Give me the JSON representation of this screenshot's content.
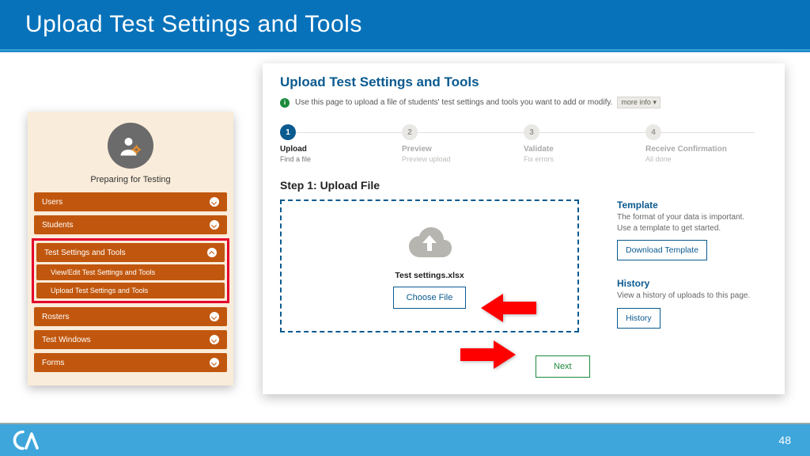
{
  "slide": {
    "title": "Upload Test Settings and Tools",
    "page_number": "48"
  },
  "sidebar": {
    "title": "Preparing for Testing",
    "items": [
      "Users",
      "Students",
      "Test Settings and Tools",
      "Rosters",
      "Test Windows",
      "Forms"
    ],
    "sub_items": [
      "View/Edit Test Settings and Tools",
      "Upload Test Settings and Tools"
    ]
  },
  "main": {
    "title": "Upload Test Settings and Tools",
    "intro": "Use this page to upload a file of students' test settings and tools you want to add or modify.",
    "more_info_label": "more info",
    "steps": [
      {
        "num": "1",
        "label": "Upload",
        "sub": "Find a file"
      },
      {
        "num": "2",
        "label": "Preview",
        "sub": "Preview upload"
      },
      {
        "num": "3",
        "label": "Validate",
        "sub": "Fix errors"
      },
      {
        "num": "4",
        "label": "Receive Confirmation",
        "sub": "All done"
      }
    ],
    "step_heading": "Step 1: Upload File",
    "filename": "Test settings.xlsx",
    "choose_file_label": "Choose File",
    "template": {
      "title": "Template",
      "desc": "The format of your data is important. Use a template to get started.",
      "button": "Download Template"
    },
    "history": {
      "title": "History",
      "desc": "View a history of uploads to this page.",
      "button": "History"
    },
    "next_label": "Next"
  }
}
